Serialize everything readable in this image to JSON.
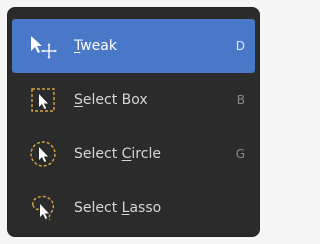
{
  "menu": {
    "items": [
      {
        "icon": "tweak-cursor-icon",
        "label_prefix": "",
        "label_u": "T",
        "label_rest": "weak",
        "shortcut": "D",
        "active": true
      },
      {
        "icon": "select-box-icon",
        "label_prefix": "",
        "label_u": "S",
        "label_rest": "elect Box",
        "shortcut": "B",
        "active": false
      },
      {
        "icon": "select-circle-icon",
        "label_prefix": "Select ",
        "label_u": "C",
        "label_rest": "ircle",
        "shortcut": "G",
        "active": false
      },
      {
        "icon": "select-lasso-icon",
        "label_prefix": "Select ",
        "label_u": "L",
        "label_rest": "asso",
        "shortcut": "",
        "active": false
      }
    ]
  },
  "colors": {
    "menu_bg": "#2b2b2b",
    "active_bg": "#4a78c8",
    "text": "#d6d6d6",
    "shortcut_text": "#8a8a8a",
    "icon_outline": "#d9a63b"
  }
}
